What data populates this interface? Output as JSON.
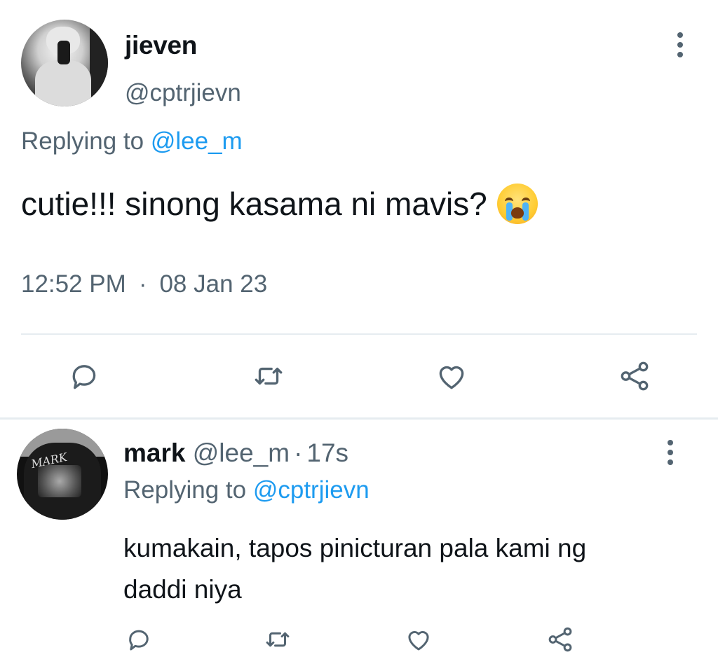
{
  "main_tweet": {
    "display_name": "jieven",
    "handle": "@cptrjievn",
    "replying_prefix": "Replying to ",
    "replying_mention": "@lee_m",
    "text": "cutie!!! sinong kasama ni mavis?",
    "emoji": "loudly-crying-face",
    "time": "12:52 PM",
    "separator": "·",
    "date": "08 Jan 23"
  },
  "reply_tweet": {
    "display_name": "mark",
    "handle": "@lee_m",
    "dot": "·",
    "age": "17s",
    "replying_prefix": "Replying to ",
    "replying_mention": "@cptrjievn",
    "text_line1": "kumakain, tapos pinicturan pala kami ng",
    "text_line2": "daddi niya",
    "avatar_logo": "MARK"
  },
  "actions": [
    "reply-icon",
    "retweet-icon",
    "like-icon",
    "share-icon"
  ],
  "colors": {
    "text_primary": "#0f1419",
    "text_secondary": "#536471",
    "mention": "#1d9bf0",
    "divider": "#e6ecf0"
  }
}
